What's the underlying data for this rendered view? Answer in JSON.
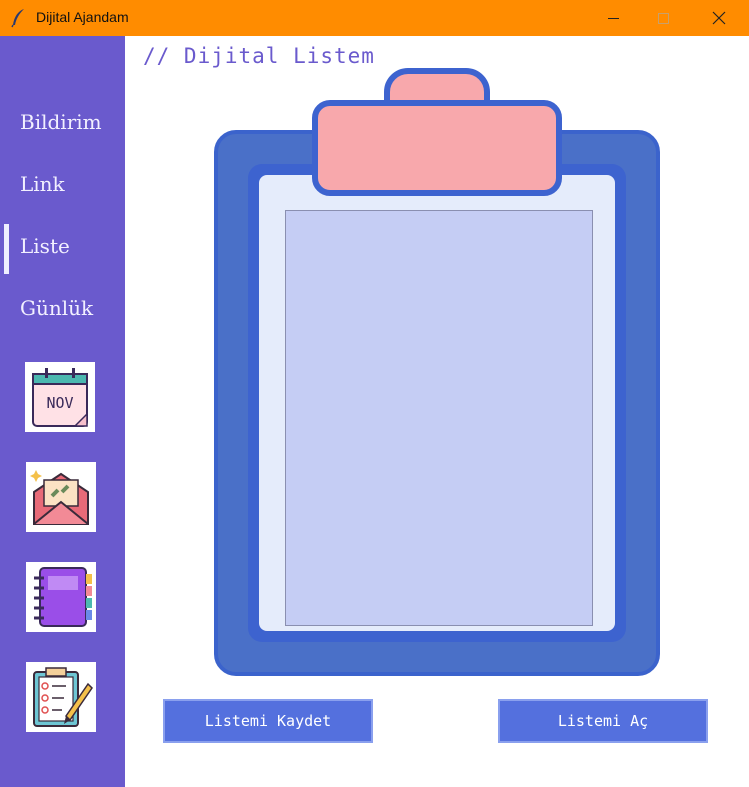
{
  "window": {
    "title": "Dijital Ajandam",
    "minimize": "—",
    "maximize": "☐",
    "close": "✕"
  },
  "sidebar": {
    "items": [
      {
        "label": "Bildirim"
      },
      {
        "label": "Link"
      },
      {
        "label": "Liste"
      },
      {
        "label": "Günlük"
      }
    ],
    "active": "Liste",
    "icons": [
      "calendar-icon",
      "mail-link-icon",
      "notebook-icon",
      "checklist-icon"
    ]
  },
  "main": {
    "heading": "// Dijital Listem",
    "list_text": "",
    "buttons": {
      "save": "Listemi Kaydet",
      "open": "Listemi Aç"
    }
  },
  "colors": {
    "titlebar": "#ff8c00",
    "sidebar": "#6a5acd",
    "heading": "#6a5acd",
    "clipboard": "#3d63cf",
    "clip_tab": "#f8a8ac",
    "list_area": "#c5cdf4",
    "button": "#5470de"
  }
}
